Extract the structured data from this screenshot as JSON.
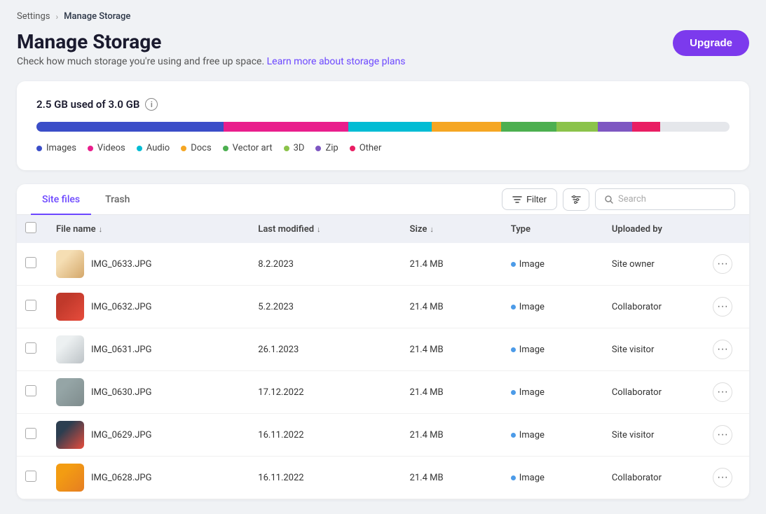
{
  "breadcrumb": {
    "parent": "Settings",
    "separator": "›",
    "current": "Manage Storage"
  },
  "page": {
    "title": "Manage Storage",
    "subtitle": "Check how much storage you're using and free up space.",
    "learn_more_link": "Learn more about storage plans",
    "upgrade_button": "Upgrade"
  },
  "storage": {
    "used_label": "2.5 GB used of 3.0 GB",
    "info_icon": "ℹ",
    "segments": [
      {
        "name": "Images",
        "color": "#3b4ec8",
        "width": "27%"
      },
      {
        "name": "Videos",
        "color": "#e91e8c",
        "width": "18%"
      },
      {
        "name": "Audio",
        "color": "#00bcd4",
        "width": "12%"
      },
      {
        "name": "Docs",
        "color": "#f5a623",
        "width": "10%"
      },
      {
        "name": "Vector art",
        "color": "#4caf50",
        "width": "8%"
      },
      {
        "name": "3D",
        "color": "#8bc34a",
        "width": "6%"
      },
      {
        "name": "Zip",
        "color": "#7e57c2",
        "width": "5%"
      },
      {
        "name": "Other",
        "color": "#e91e63",
        "width": "4%"
      }
    ],
    "legend": [
      {
        "label": "Images",
        "color": "#3b4ec8"
      },
      {
        "label": "Videos",
        "color": "#e91e8c"
      },
      {
        "label": "Audio",
        "color": "#00bcd4"
      },
      {
        "label": "Docs",
        "color": "#f5a623"
      },
      {
        "label": "Vector art",
        "color": "#4caf50"
      },
      {
        "label": "3D",
        "color": "#8bc34a"
      },
      {
        "label": "Zip",
        "color": "#7e57c2"
      },
      {
        "label": "Other",
        "color": "#e91e63"
      }
    ]
  },
  "tabs": [
    {
      "id": "site-files",
      "label": "Site files",
      "active": true
    },
    {
      "id": "trash",
      "label": "Trash",
      "active": false
    }
  ],
  "toolbar": {
    "filter_label": "Filter",
    "search_placeholder": "Search"
  },
  "table": {
    "columns": [
      {
        "id": "checkbox",
        "label": ""
      },
      {
        "id": "file_name",
        "label": "File name",
        "sortable": true
      },
      {
        "id": "last_modified",
        "label": "Last modified",
        "sortable": true
      },
      {
        "id": "size",
        "label": "Size",
        "sortable": true
      },
      {
        "id": "type",
        "label": "Type"
      },
      {
        "id": "uploaded_by",
        "label": "Uploaded by"
      },
      {
        "id": "actions",
        "label": ""
      }
    ],
    "rows": [
      {
        "id": 1,
        "name": "IMG_0633.JPG",
        "modified": "8.2.2023",
        "size": "21.4 MB",
        "type": "Image",
        "uploaded_by": "Site owner",
        "thumb": "food1"
      },
      {
        "id": 2,
        "name": "IMG_0632.JPG",
        "modified": "5.2.2023",
        "size": "21.4 MB",
        "type": "Image",
        "uploaded_by": "Collaborator",
        "thumb": "food2"
      },
      {
        "id": 3,
        "name": "IMG_0631.JPG",
        "modified": "26.1.2023",
        "size": "21.4 MB",
        "type": "Image",
        "uploaded_by": "Site visitor",
        "thumb": "food3"
      },
      {
        "id": 4,
        "name": "IMG_0630.JPG",
        "modified": "17.12.2022",
        "size": "21.4 MB",
        "type": "Image",
        "uploaded_by": "Collaborator",
        "thumb": "food4"
      },
      {
        "id": 5,
        "name": "IMG_0629.JPG",
        "modified": "16.11.2022",
        "size": "21.4 MB",
        "type": "Image",
        "uploaded_by": "Site visitor",
        "thumb": "food5"
      },
      {
        "id": 6,
        "name": "IMG_0628.JPG",
        "modified": "16.11.2022",
        "size": "21.4 MB",
        "type": "Image",
        "uploaded_by": "Collaborator",
        "thumb": "food6"
      }
    ]
  }
}
